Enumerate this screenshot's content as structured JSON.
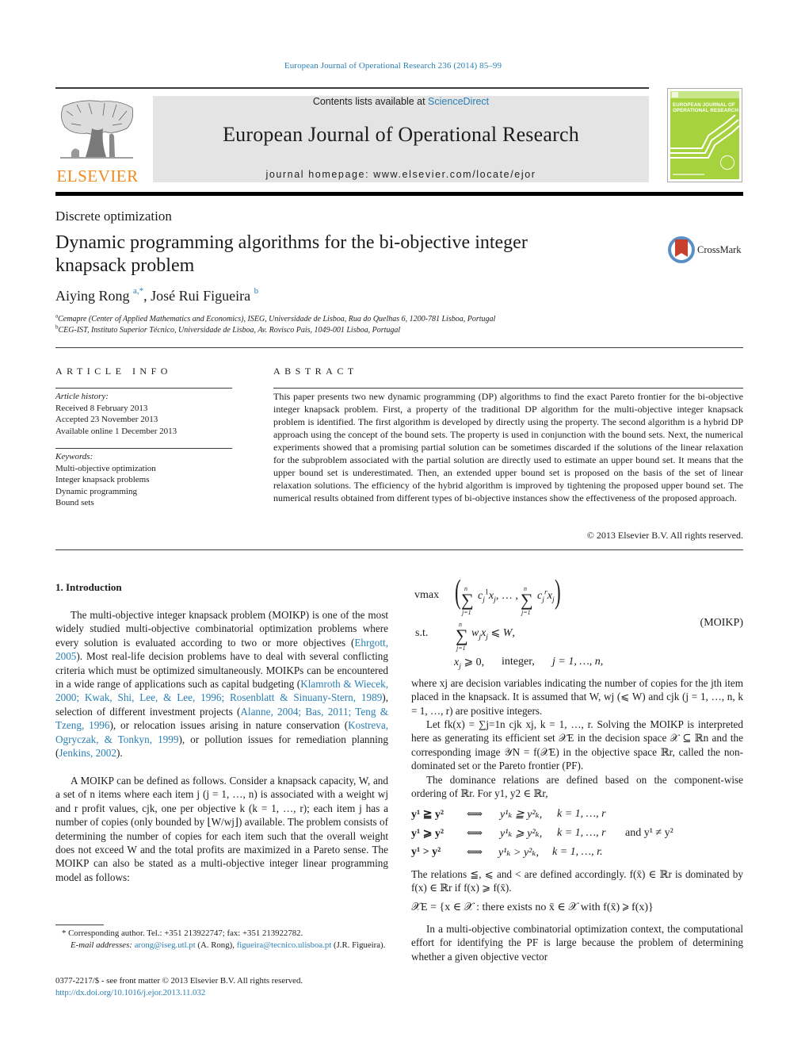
{
  "citation": "European Journal of Operational Research 236 (2014) 85–99",
  "masthead": {
    "publisher_logo_text": "ELSEVIER",
    "contents_prefix": "Contents lists available at ",
    "contents_link": "ScienceDirect",
    "journal_name": "European Journal of Operational Research",
    "homepage_line": "journal homepage: www.elsevier.com/locate/ejor",
    "cover_title_line1": "EUROPEAN JOURNAL OF",
    "cover_title_line2": "OPERATIONAL RESEARCH",
    "colors": {
      "publisher_orange": "#f08a1e",
      "banner_gray": "#e4e4e4",
      "cover_green": "#a6d23e",
      "link_blue": "#2a7fb5"
    }
  },
  "section_label": "Discrete optimization",
  "title_line1": "Dynamic programming algorithms for the bi-objective integer",
  "title_line2": "knapsack problem",
  "crossmark_label": "CrossMark",
  "authors": [
    {
      "name": "Aiying Rong",
      "marks": "a,*"
    },
    {
      "name": "José Rui Figueira",
      "marks": "b"
    }
  ],
  "affiliations": [
    {
      "mark": "a",
      "text": "Cemapre (Center of Applied Mathematics and Economics), ISEG, Universidade de Lisboa, Rua do Quelhas 6, 1200-781 Lisboa, Portugal"
    },
    {
      "mark": "b",
      "text": "CEG-IST, Instituto Superior Técnico, Universidade de Lisboa, Av. Rovisco Pais, 1049-001 Lisboa, Portugal"
    }
  ],
  "article_info": {
    "heading": "ARTICLE INFO",
    "history_label": "Article history:",
    "history": [
      "Received 8 February 2013",
      "Accepted 23 November 2013",
      "Available online 1 December 2013"
    ],
    "keywords_label": "Keywords:",
    "keywords": [
      "Multi-objective optimization",
      "Integer knapsack problems",
      "Dynamic programming",
      "Bound sets"
    ]
  },
  "abstract": {
    "heading": "ABSTRACT",
    "text": "This paper presents two new dynamic programming (DP) algorithms to find the exact Pareto frontier for the bi-objective integer knapsack problem. First, a property of the traditional DP algorithm for the multi-objective integer knapsack problem is identified. The first algorithm is developed by directly using the property. The second algorithm is a hybrid DP approach using the concept of the bound sets. The property is used in conjunction with the bound sets. Next, the numerical experiments showed that a promising partial solution can be sometimes discarded if the solutions of the linear relaxation for the subproblem associated with the partial solution are directly used to estimate an upper bound set. It means that the upper bound set is underestimated. Then, an extended upper bound set is proposed on the basis of the set of linear relaxation solutions. The efficiency of the hybrid algorithm is improved by tightening the proposed upper bound set. The numerical results obtained from different types of bi-objective instances show the effectiveness of the proposed approach.",
    "copyright": "© 2013 Elsevier B.V. All rights reserved."
  },
  "intro": {
    "heading": "1. Introduction",
    "p1_a": "The multi-objective integer knapsack problem (MOIKP) is one of the most widely studied multi-objective combinatorial optimization problems where every solution is evaluated according to two or more objectives (",
    "cite_ehrgott": "Ehrgott, 2005",
    "p1_b": "). Most real-life decision problems have to deal with several conflicting criteria which must be optimized simultaneously. MOIKPs can be encountered in a wide range of applications such as capital budgeting (",
    "cite_capital": "Klamroth & Wiecek, 2000; Kwak, Shi, Lee, & Lee, 1996; Rosenblatt & Sinuany-Stern, 1989",
    "p1_c": "), selection of different investment projects (",
    "cite_invest": "Alanne, 2004; Bas, 2011; Teng & Tzeng, 1996",
    "p1_d": "), or relocation issues arising in nature conservation (",
    "cite_nature": "Kostreva, Ogryczak, & Tonkyn, 1999",
    "p1_e": "), or pollution issues for remediation planning (",
    "cite_pollution": "Jenkins, 2002",
    "p1_f": ").",
    "p2": "A MOIKP can be defined as follows. Consider a knapsack capacity, W, and a set of n items where each item j (j = 1, …, n) is associated with a weight wj and r profit values, cjk, one per objective k (k = 1, …, r); each item j has a number of copies (only bounded by ⌊W/wj⌋) available. The problem consists of determining the number of copies for each item such that the overall weight does not exceed W and the total profits are maximized in a Pareto sense. The MOIKP can also be stated as a multi-objective integer linear programming model as follows:"
  },
  "footnote": {
    "star": "*",
    "corresponding": "Corresponding author. Tel.: +351 213922747; fax: +351 213922782.",
    "email_label": "E-mail addresses:",
    "email1": "arong@iseg.utl.pt",
    "email1_owner": "(A. Rong),",
    "email2": "figueira@tecnico.ulisboa.pt",
    "email2_owner": "(J.R. Figueira)."
  },
  "issn_line": "0377-2217/$ - see front matter © 2013 Elsevier B.V. All rights reserved.",
  "doi": "http://dx.doi.org/10.1016/j.ejor.2013.11.032",
  "model": {
    "objective_label": "vmax",
    "constraint_label": "s.t.",
    "tag": "(MOIKP)",
    "integer_word": "integer,",
    "index_range": "j = 1, …, n,"
  },
  "right_col": {
    "p1": "where xj are decision variables indicating the number of copies for the jth item placed in the knapsack. It is assumed that W, wj (⩽ W) and cjk (j = 1, …, n, k = 1, …, r) are positive integers.",
    "p2": "Let fk(x) = ∑j=1n cjk xj, k = 1, …, r. Solving the MOIKP is interpreted here as generating its efficient set 𝒳E in the decision space 𝒳 ⊆ ℝn and the corresponding image 𝒴N = f(𝒳E) in the objective space ℝr, called the non-dominated set or the Pareto frontier (PF).",
    "p3": "The dominance relations are defined based on the component-wise ordering of ℝr. For y1, y2 ∈ ℝr,",
    "dominance_rows": [
      {
        "lhs": "y¹ ≧ y²",
        "iff": "⟺",
        "rhs": "y¹ₖ ≧ y²ₖ,",
        "range": "k = 1, …, r",
        "extra": ""
      },
      {
        "lhs": "y¹ ⩾ y²",
        "iff": "⟺",
        "rhs": "y¹ₖ ⩾ y²ₖ,",
        "range": "k = 1, …, r",
        "extra": "and   y¹ ≠ y²"
      },
      {
        "lhs": "y¹ > y²",
        "iff": "⟺",
        "rhs": "y¹ₖ > y²ₖ,",
        "range": "k = 1, …, r.",
        "extra": ""
      }
    ],
    "p4": "The relations ≦, ⩽ and < are defined accordingly. f(x̄) ∈ ℝr is dominated by f(x) ∈ ℝr if f(x) ⩾ f(x̄).",
    "xe_definition": "𝒳E = {x ∈ 𝒳 :  there exists no x̄ ∈ 𝒳 with f(x̄) ⩾ f(x)}",
    "p5": "In a multi-objective combinatorial optimization context, the computational effort for identifying the PF is large because the problem of determining whether a given objective vector"
  }
}
